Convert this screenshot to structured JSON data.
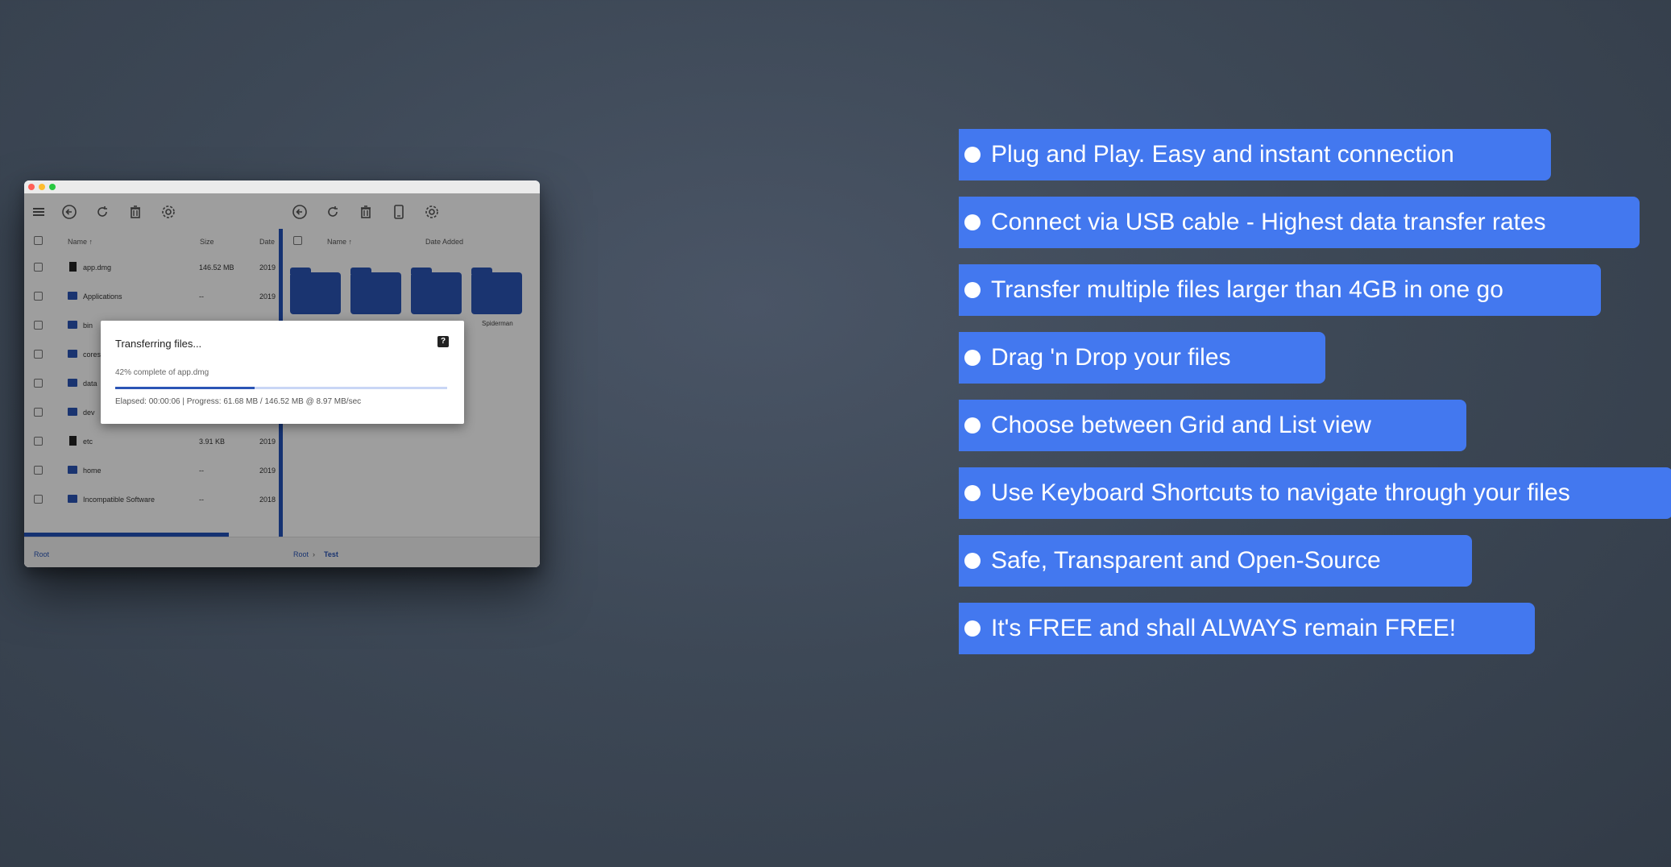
{
  "window": {
    "left_pane": {
      "columns": {
        "name": "Name",
        "size": "Size",
        "date": "Date"
      },
      "rows": [
        {
          "name": "app.dmg",
          "size": "146.52 MB",
          "date": "2019",
          "kind": "file"
        },
        {
          "name": "Applications",
          "size": "--",
          "date": "2019",
          "kind": "folder"
        },
        {
          "name": "bin",
          "size": "",
          "date": "",
          "kind": "folder"
        },
        {
          "name": "cores",
          "size": "",
          "date": "",
          "kind": "folder"
        },
        {
          "name": "data",
          "size": "",
          "date": "",
          "kind": "folder"
        },
        {
          "name": "dev",
          "size": "",
          "date": "",
          "kind": "folder"
        },
        {
          "name": "etc",
          "size": "3.91 KB",
          "date": "2019",
          "kind": "file"
        },
        {
          "name": "home",
          "size": "--",
          "date": "2019",
          "kind": "folder"
        },
        {
          "name": "Incompatible Software",
          "size": "--",
          "date": "2018",
          "kind": "folder"
        }
      ],
      "breadcrumb_root": "Root"
    },
    "right_pane": {
      "columns": {
        "name": "Name",
        "date_added": "Date Added"
      },
      "folders": [
        "",
        "",
        "",
        "Spiderman"
      ],
      "breadcrumb_root": "Root",
      "breadcrumb_sep": "›",
      "breadcrumb_current": "Test"
    },
    "dialog": {
      "title": "Transferring files...",
      "help_icon": "?",
      "subtitle": "42% complete of app.dmg",
      "progress_percent": 42,
      "status": "Elapsed: 00:00:06 | Progress: 61.68 MB / 146.52 MB @ 8.97 MB/sec"
    },
    "sort_arrow": "↑"
  },
  "features": [
    "Plug and Play. Easy and instant connection",
    "Connect via USB cable - Highest data transfer rates",
    "Transfer multiple files larger than 4GB in one go",
    "Drag 'n Drop your files",
    "Choose between Grid and List view",
    "Use Keyboard Shortcuts to navigate through your files",
    "Safe, Transparent and Open-Source",
    "It's FREE and shall ALWAYS remain FREE!"
  ],
  "colors": {
    "accent": "#4378ef",
    "folder": "#2b55b5",
    "background": "#3d4856"
  }
}
